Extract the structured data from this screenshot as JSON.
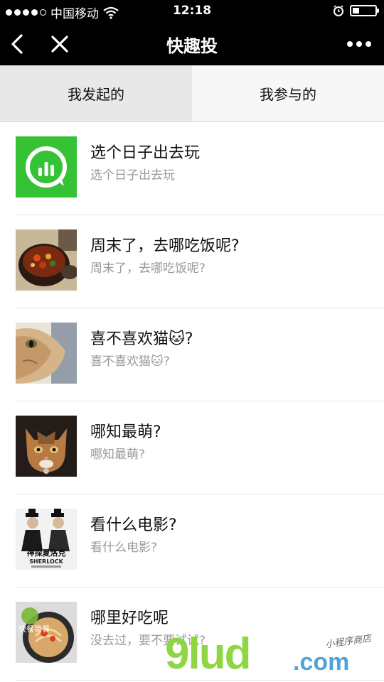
{
  "status_bar": {
    "carrier": "中国移动",
    "time": "12:18"
  },
  "nav": {
    "title": "快趣投"
  },
  "tabs": [
    {
      "label": "我发起的",
      "active": true
    },
    {
      "label": "我参与的",
      "active": false
    }
  ],
  "items": [
    {
      "title": "选个日子出去玩",
      "subtitle": "选个日子出去玩",
      "thumb": "poll-logo-icon"
    },
    {
      "title": "周末了，去哪吃饭呢?",
      "subtitle": "周末了，去哪吃饭呢?",
      "thumb": "food-photo"
    },
    {
      "title": "喜不喜欢猫🐱?",
      "subtitle": "喜不喜欢猫🐱?",
      "thumb": "cat-photo"
    },
    {
      "title": "哪知最萌?",
      "subtitle": "哪知最萌?",
      "thumb": "kitten-photo"
    },
    {
      "title": "看什么电影?",
      "subtitle": "看什么电影?",
      "thumb": "movie-poster"
    },
    {
      "title": "哪里好吃呢",
      "subtitle": "没去过，要不要试试?",
      "thumb": "noodle-photo"
    }
  ],
  "thumb_texts": {
    "movie_title_cn": "神探夏洛克",
    "movie_title_en": "SHERLOCK",
    "noodle_label": "快餐简餐"
  },
  "watermark": {
    "big": "9lud",
    "com": ".com",
    "small": "小程序商店"
  },
  "colors": {
    "bar": "#000000",
    "poll_green": "#35c335",
    "watermark_green": "#8bd43a",
    "watermark_blue": "#4fa3d9"
  }
}
